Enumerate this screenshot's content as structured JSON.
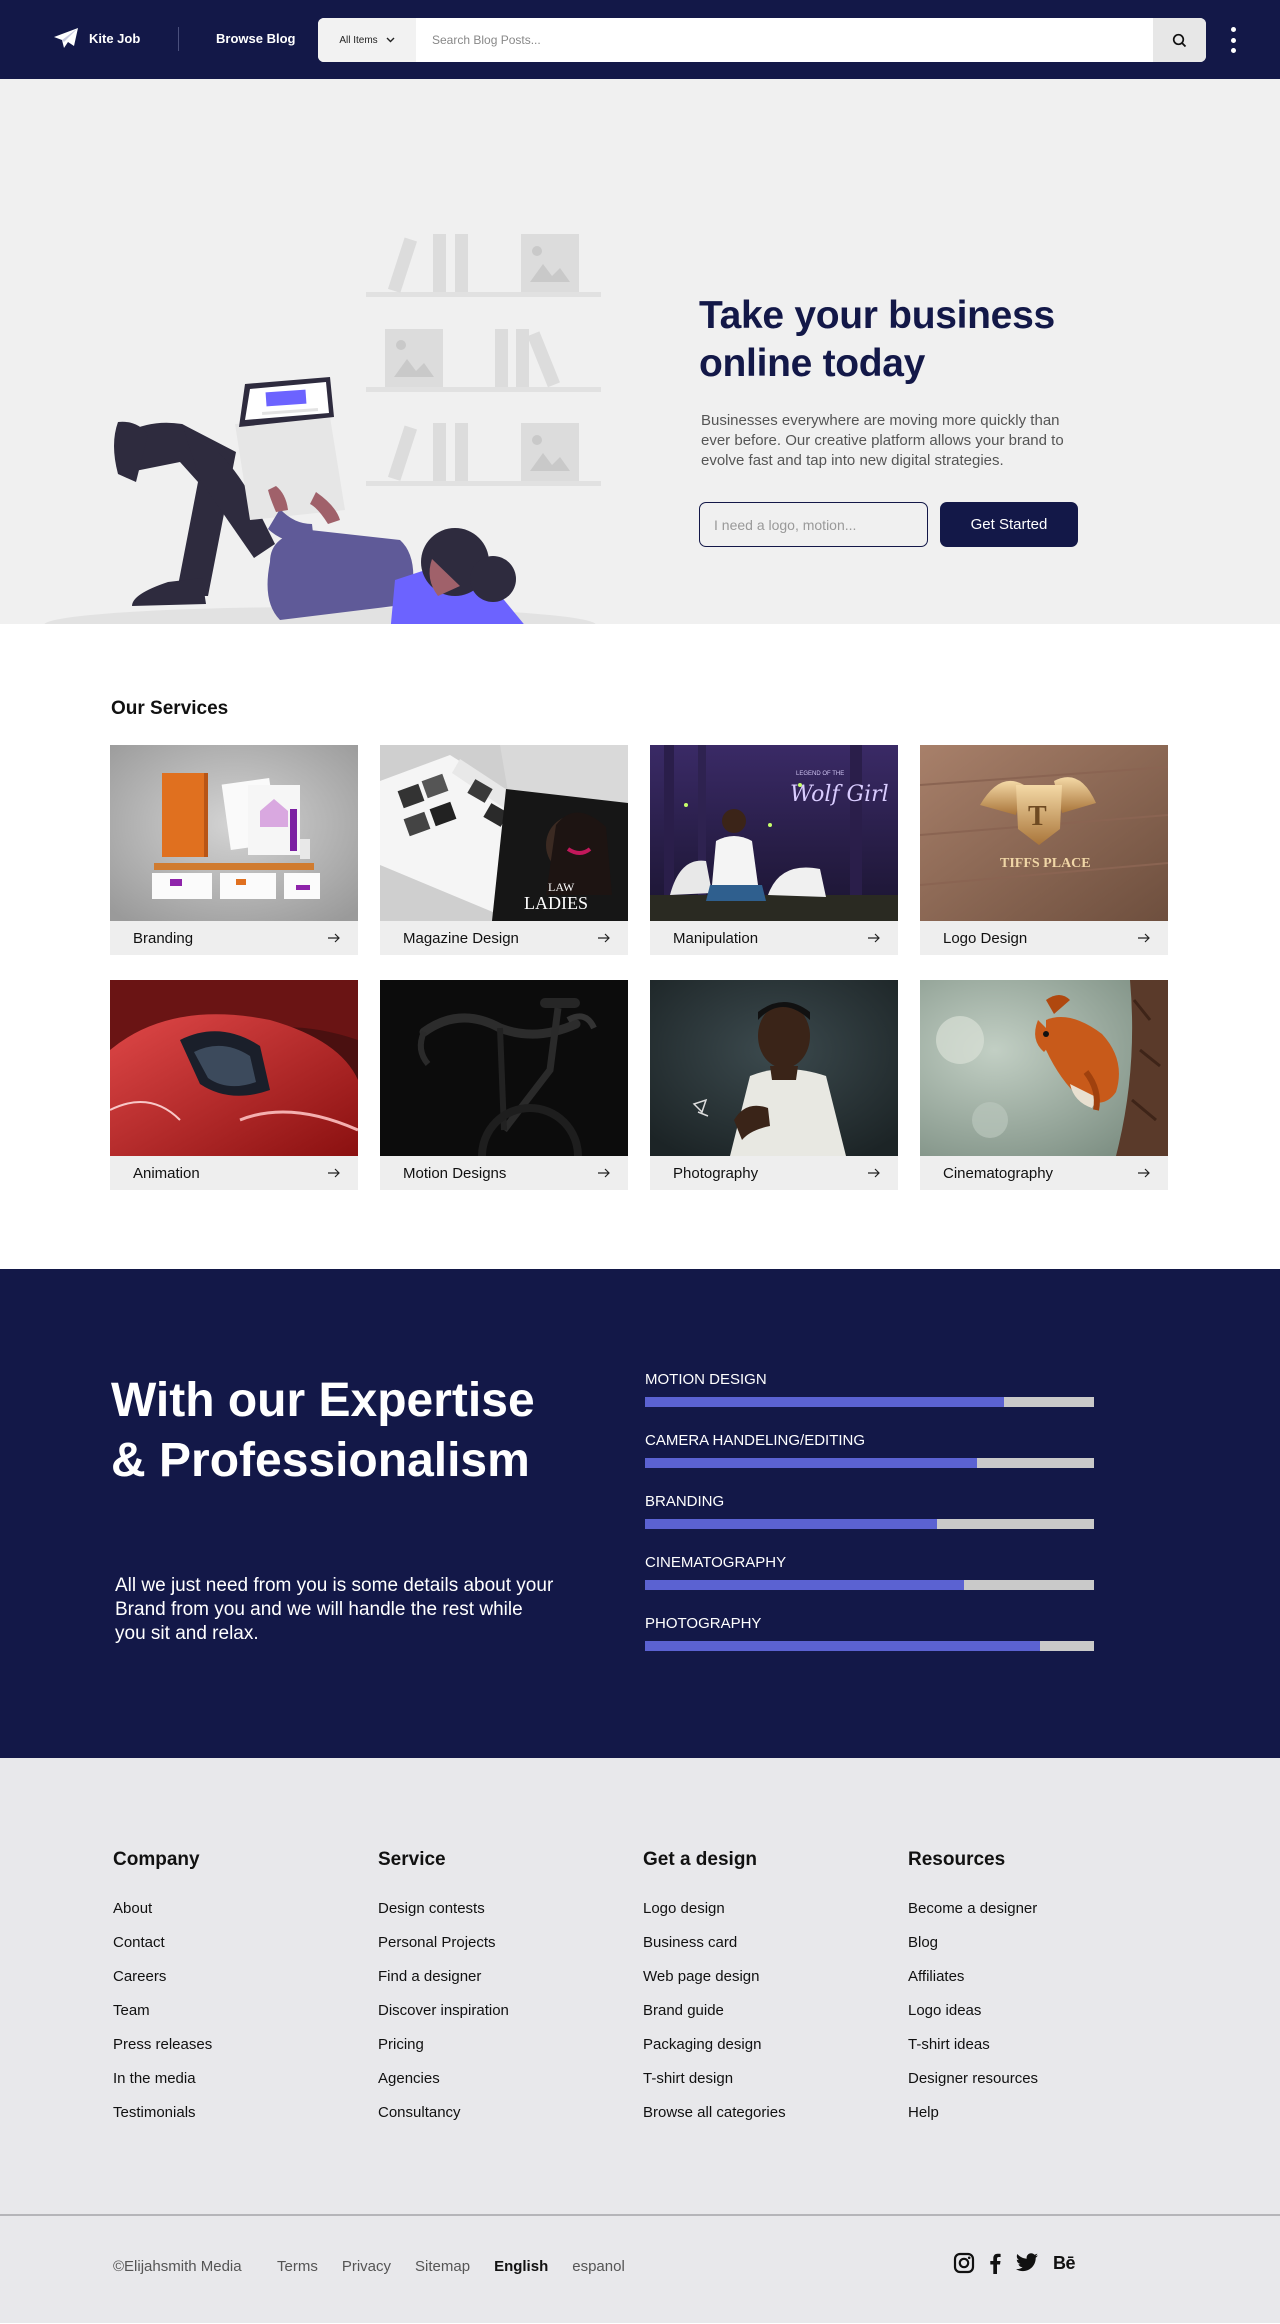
{
  "nav": {
    "brand": "Kite Job",
    "browse_link": "Browse Blog",
    "search_category": "All Items",
    "search_placeholder": "Search Blog Posts..."
  },
  "hero": {
    "title": "Take your business online today",
    "description": "Businesses everywhere are moving more quickly than ever before. Our creative platform allows your brand to evolve fast and tap into new digital strategies.",
    "input_placeholder": "I need a logo, motion...",
    "cta_label": "Get Started"
  },
  "services": {
    "title": "Our Services",
    "items": [
      {
        "label": "Branding"
      },
      {
        "label": "Magazine Design"
      },
      {
        "label": "Manipulation"
      },
      {
        "label": "Logo Design"
      },
      {
        "label": "Animation"
      },
      {
        "label": "Motion Designs"
      },
      {
        "label": "Photography"
      },
      {
        "label": "Cinematography"
      }
    ],
    "image_text": {
      "magazine_line1": "LAW",
      "magazine_line2": "LADIES",
      "manip_small": "LEGEND OF THE",
      "manip_title": "Wolf Girl",
      "logo_letter": "T",
      "logo_name": "TIFFS PLACE"
    }
  },
  "expertise": {
    "title": "With our Expertise & Professionalism",
    "description": "All we just need from you is some details about your Brand from you and we will handle the rest while you sit and relax.",
    "skills": [
      {
        "label": "MOTION DESIGN",
        "percent": 80
      },
      {
        "label": "CAMERA HANDELING/EDITING",
        "percent": 74
      },
      {
        "label": "BRANDING",
        "percent": 65
      },
      {
        "label": "CINEMATOGRAPHY",
        "percent": 71
      },
      {
        "label": "PHOTOGRAPHY",
        "percent": 88
      }
    ]
  },
  "footer": {
    "columns": [
      {
        "title": "Company",
        "links": [
          "About",
          "Contact",
          "Careers",
          "Team",
          "Press releases",
          "In the media",
          "Testimonials"
        ]
      },
      {
        "title": "Service",
        "links": [
          "Design contests",
          "Personal Projects",
          "Find a designer",
          "Discover inspiration",
          "Pricing",
          "Agencies",
          "Consultancy"
        ]
      },
      {
        "title": "Get a design",
        "links": [
          "Logo design",
          "Business card",
          "Web page design",
          "Brand guide",
          "Packaging design",
          "T-shirt design",
          "Browse all categories"
        ]
      },
      {
        "title": "Resources",
        "links": [
          "Become a designer",
          "Blog",
          "Affiliates",
          "Logo ideas",
          "T-shirt ideas",
          "Designer resources",
          "Help"
        ]
      }
    ],
    "copyright": "©Elijahsmith Media",
    "bottom_links": [
      "Terms",
      "Privacy",
      "Sitemap",
      "English",
      "espanol"
    ],
    "behance": "Bē"
  },
  "colors": {
    "navy": "#131848",
    "accent": "#5b62d2",
    "hero_bg": "#f0f0f0",
    "footer_bg": "#e8e8eb"
  }
}
